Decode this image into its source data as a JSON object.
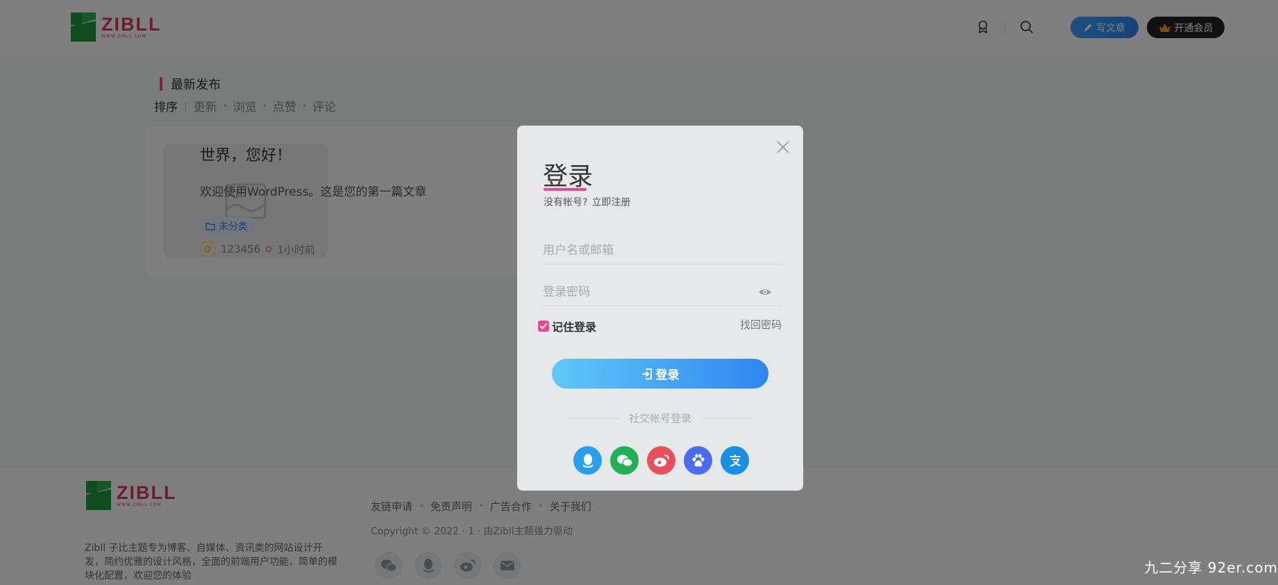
{
  "header": {
    "logo_word": "ZIBLL",
    "logo_url": "WWW.ZIBLL.COM",
    "write_label": "写文章",
    "vip_label": "开通会员"
  },
  "content": {
    "section_title": "最新发布",
    "sort_items": [
      "排序",
      "更新",
      "浏览",
      "点赞",
      "评论"
    ],
    "post": {
      "title": "世界，您好！",
      "excerpt": "欢迎使用WordPress。这是您的第一篇文章",
      "category": "未分类",
      "author": "123456",
      "time": "1小时前"
    }
  },
  "footer": {
    "logo_word": "ZIBLL",
    "logo_url": "WWW.ZIBLL.COM",
    "description": "Zibll 子比主题专为博客、自媒体、资讯类的网站设计开发，简约优雅的设计风格，全面的前端用户功能，简单的模块化配置，欢迎您的体验",
    "links": [
      "友链申请",
      "免责声明",
      "广告合作",
      "关于我们"
    ],
    "copyright": "Copyright © 2022 · 1 · 由Zibll主题强力驱动"
  },
  "modal": {
    "title": "登录",
    "no_account": "没有帐号?",
    "register": "立即注册",
    "username_placeholder": "用户名或邮箱",
    "password_placeholder": "登录密码",
    "remember": "记住登录",
    "forgot": "找回密码",
    "login_btn": "登录",
    "social_title": "社交帐号登录",
    "social": [
      {
        "name": "qq-icon",
        "color": "#2a9ff0"
      },
      {
        "name": "wechat-icon",
        "color": "#21b155"
      },
      {
        "name": "weibo-icon",
        "color": "#e9505a"
      },
      {
        "name": "baidu-icon",
        "color": "#4a6cf0"
      },
      {
        "name": "alipay-icon",
        "color": "#1a8fe6"
      }
    ]
  },
  "watermark": "九二分享 92er.com",
  "colors": {
    "accent": "#f04494",
    "primary": "#2e86f0"
  }
}
